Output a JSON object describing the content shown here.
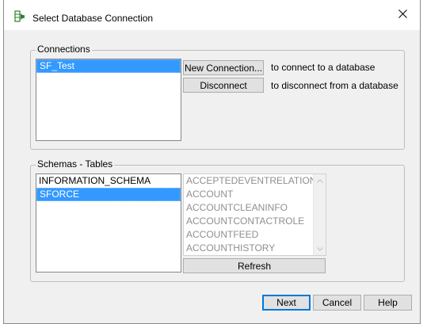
{
  "window": {
    "title": "Select Database Connection"
  },
  "connections": {
    "legend": "Connections",
    "items": [
      {
        "label": "SF_Test",
        "selected": true
      }
    ],
    "new_connection_label": "New Connection...",
    "new_connection_hint": "to connect to a database",
    "disconnect_label": "Disconnect",
    "disconnect_hint": "to disconnect from a database"
  },
  "schemas_tables": {
    "legend": "Schemas - Tables",
    "schemas": [
      {
        "label": "INFORMATION_SCHEMA",
        "selected": false
      },
      {
        "label": "SFORCE",
        "selected": true
      }
    ],
    "tables": [
      "ACCEPTEDEVENTRELATION",
      "ACCOUNT",
      "ACCOUNTCLEANINFO",
      "ACCOUNTCONTACTROLE",
      "ACCOUNTFEED",
      "ACCOUNTHISTORY"
    ],
    "refresh_label": "Refresh"
  },
  "footer": {
    "next_label": "Next",
    "cancel_label": "Cancel",
    "help_label": "Help"
  },
  "icons": {
    "title": "database-table-icon",
    "close": "close-icon"
  },
  "colors": {
    "selection": "#3399ff",
    "default_button_border": "#0078d7",
    "disabled_text": "#8f8f8f"
  }
}
